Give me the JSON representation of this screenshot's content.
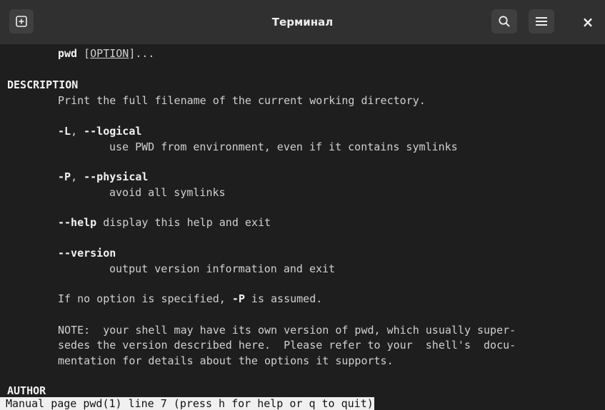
{
  "window": {
    "title": "Терминал",
    "new_tab_icon": "plus-square-icon",
    "search_icon": "search-icon",
    "menu_icon": "hamburger-menu-icon",
    "close_icon": "close-icon",
    "close_glyph": "×"
  },
  "manpage": {
    "synopsis": {
      "cmd": "pwd",
      "sp": " ",
      "lb": "[",
      "option": "OPTION",
      "rb": "]..."
    },
    "description_heading": "DESCRIPTION",
    "description_text": "Print the full filename of the current working directory.",
    "opt_L": {
      "short": "-L",
      "sep": ", ",
      "long": "--logical",
      "desc": "use PWD from environment, even if it contains symlinks"
    },
    "opt_P": {
      "short": "-P",
      "sep": ", ",
      "long": "--physical",
      "desc": "avoid all symlinks"
    },
    "opt_help": {
      "flag": "--help",
      "desc": " display this help and exit"
    },
    "opt_version": {
      "flag": "--version",
      "desc": "output version information and exit"
    },
    "default_note": {
      "pre": "If no option is specified, ",
      "flag": "-P",
      "post": " is assumed."
    },
    "note_lines": [
      "NOTE:  your shell may have its own version of pwd, which usually super-",
      "sedes the version described here.  Please refer to your  shell's  docu-",
      "mentation for details about the options it supports."
    ],
    "author_heading": "AUTHOR"
  },
  "status": {
    "text": "Manual page pwd(1) line 7 (press h for help or q to quit)"
  },
  "colors": {
    "background": "#1e1e1e",
    "headerbar": "#303030",
    "text": "#d0d0d0",
    "status_bg": "#f0f0f0"
  }
}
